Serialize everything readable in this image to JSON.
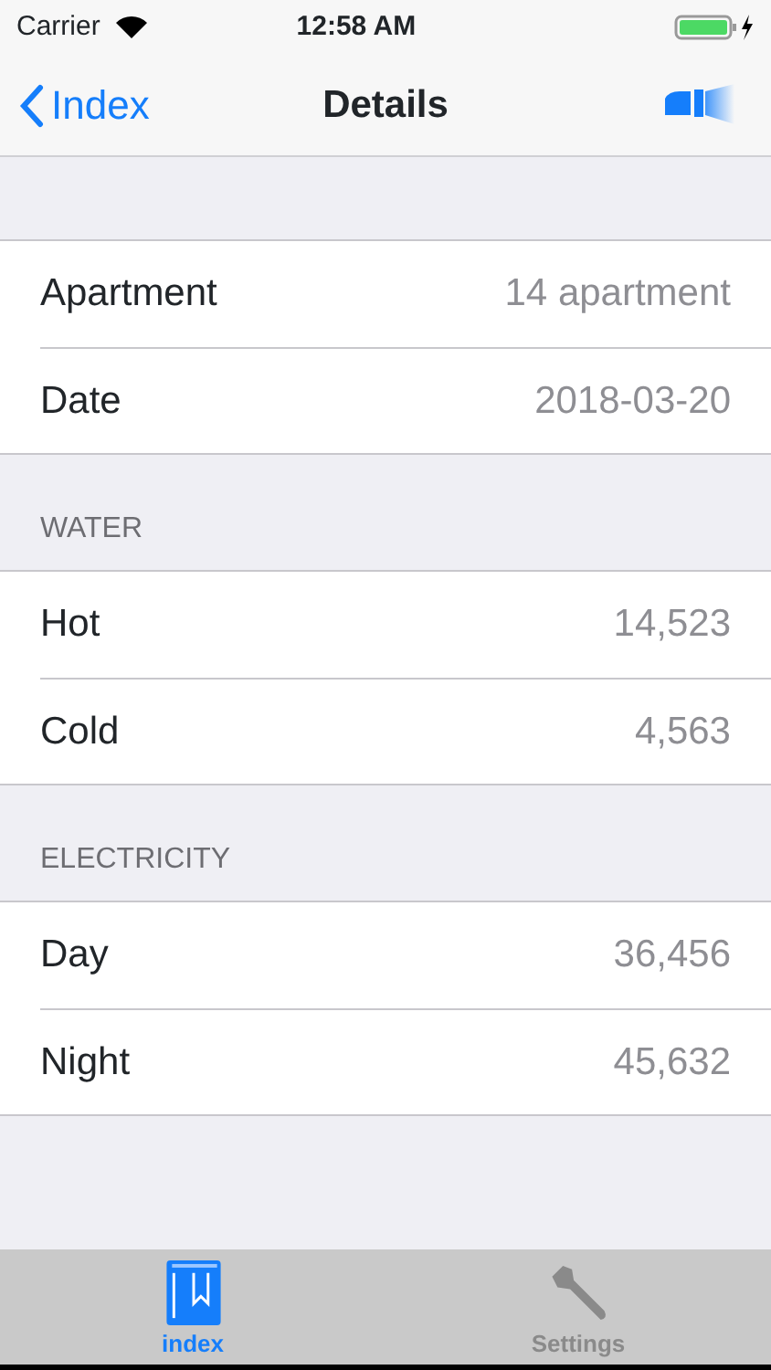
{
  "status_bar": {
    "carrier": "Carrier",
    "time": "12:58 AM"
  },
  "nav": {
    "back": "Index",
    "title": "Details"
  },
  "sections": [
    {
      "rows": [
        {
          "label": "Apartment",
          "value": "14 apartment"
        },
        {
          "label": "Date",
          "value": "2018-03-20"
        }
      ]
    },
    {
      "header": "WATER",
      "rows": [
        {
          "label": "Hot",
          "value": "14,523"
        },
        {
          "label": "Cold",
          "value": "4,563"
        }
      ]
    },
    {
      "header": "ELECTRICITY",
      "rows": [
        {
          "label": "Day",
          "value": "36,456"
        },
        {
          "label": "Night",
          "value": "45,632"
        }
      ]
    }
  ],
  "tabs": [
    {
      "label": "index",
      "kind": "book",
      "selected": true
    },
    {
      "label": "Settings",
      "kind": "wrench",
      "selected": false
    }
  ]
}
